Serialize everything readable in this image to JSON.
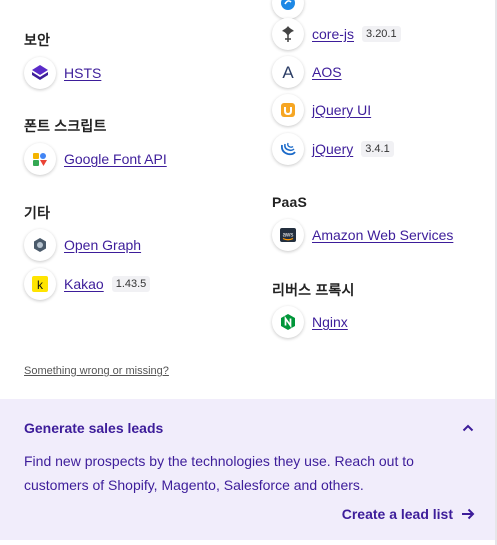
{
  "left": {
    "sections": [
      {
        "heading": "보안",
        "items": [
          {
            "name": "HSTS",
            "version": "",
            "icon": "hsts-icon"
          }
        ]
      },
      {
        "heading": "폰트 스크립트",
        "items": [
          {
            "name": "Google Font API",
            "version": "",
            "icon": "google-font-api-icon"
          }
        ]
      },
      {
        "heading": "기타",
        "items": [
          {
            "name": "Open Graph",
            "version": "",
            "icon": "open-graph-icon"
          },
          {
            "name": "Kakao",
            "version": "1.43.5",
            "icon": "kakao-icon"
          }
        ]
      }
    ]
  },
  "right": {
    "top_items": [
      {
        "name": "core-js",
        "version": "3.20.1",
        "icon": "core-js-icon"
      },
      {
        "name": "AOS",
        "version": "",
        "icon": "aos-icon"
      },
      {
        "name": "jQuery UI",
        "version": "",
        "icon": "jquery-ui-icon"
      },
      {
        "name": "jQuery",
        "version": "3.4.1",
        "icon": "jquery-icon"
      }
    ],
    "sections": [
      {
        "heading": "PaaS",
        "items": [
          {
            "name": "Amazon Web Services",
            "version": "",
            "icon": "aws-icon"
          }
        ]
      },
      {
        "heading": "리버스 프록시",
        "items": [
          {
            "name": "Nginx",
            "version": "",
            "icon": "nginx-icon"
          }
        ]
      }
    ]
  },
  "wrong_link": "Something wrong or missing?",
  "lead": {
    "title": "Generate sales leads",
    "description": "Find new prospects by the technologies they use. Reach out to customers of Shopify, Magento, Salesforce and others.",
    "cta": "Create a lead list"
  },
  "colors": {
    "accent": "#3d1d9a",
    "panel_bg": "#f1edfb"
  }
}
